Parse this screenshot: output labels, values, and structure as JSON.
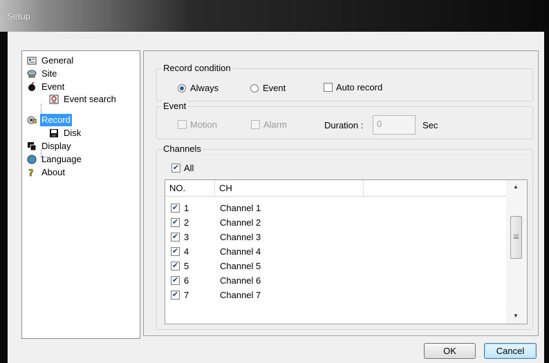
{
  "window": {
    "title": "Setup"
  },
  "tree": {
    "items": [
      {
        "label": "General",
        "icon": "general-icon"
      },
      {
        "label": "Site",
        "icon": "site-icon"
      },
      {
        "label": "Event",
        "icon": "event-icon"
      },
      {
        "label": "Event search",
        "icon": "event-search-icon"
      },
      {
        "label": "Record",
        "icon": "record-icon",
        "selected": true
      },
      {
        "label": "Disk",
        "icon": "disk-icon"
      },
      {
        "label": "Display",
        "icon": "display-icon"
      },
      {
        "label": "Language",
        "icon": "language-icon"
      },
      {
        "label": "About",
        "icon": "about-icon"
      }
    ]
  },
  "record_condition": {
    "title": "Record condition",
    "always_label": "Always",
    "event_label": "Event",
    "auto_record_label": "Auto record",
    "selected": "Always",
    "auto_record_checked": false
  },
  "event": {
    "title": "Event",
    "motion_label": "Motion",
    "alarm_label": "Alarm",
    "duration_label": "Duration :",
    "duration_value": "0",
    "sec_label": "Sec"
  },
  "channels": {
    "title": "Channels",
    "all_label": "All",
    "all_checked": true,
    "columns": [
      "NO.",
      "CH",
      ""
    ],
    "rows": [
      {
        "no": "1",
        "ch": "Channel 1",
        "checked": true
      },
      {
        "no": "2",
        "ch": "Channel 2",
        "checked": true
      },
      {
        "no": "3",
        "ch": "Channel 3",
        "checked": true
      },
      {
        "no": "4",
        "ch": "Channel 4",
        "checked": true
      },
      {
        "no": "5",
        "ch": "Channel 5",
        "checked": true
      },
      {
        "no": "6",
        "ch": "Channel 6",
        "checked": true
      },
      {
        "no": "7",
        "ch": "Channel 7",
        "checked": true
      }
    ]
  },
  "buttons": {
    "ok": "OK",
    "cancel": "Cancel"
  },
  "colors": {
    "selection": "#3399ff",
    "default_button_border": "#3c7fb1",
    "titlebar": "#0a0a0a"
  }
}
